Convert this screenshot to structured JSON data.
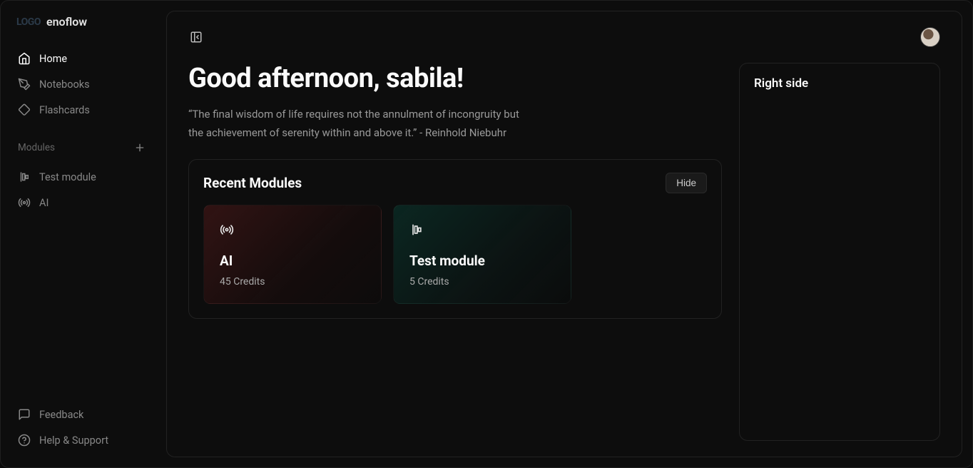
{
  "brand": {
    "logo": "LOGO",
    "name": "enoflow"
  },
  "nav": {
    "primary": [
      {
        "label": "Home",
        "icon": "home-icon",
        "active": true
      },
      {
        "label": "Notebooks",
        "icon": "pen-icon",
        "active": false
      },
      {
        "label": "Flashcards",
        "icon": "diamond-icon",
        "active": false
      }
    ],
    "modules_label": "Modules",
    "module_items": [
      {
        "label": "Test module",
        "icon": "align-icon"
      },
      {
        "label": "AI",
        "icon": "radio-icon"
      }
    ],
    "footer": [
      {
        "label": "Feedback",
        "icon": "message-icon"
      },
      {
        "label": "Help & Support",
        "icon": "help-icon"
      }
    ]
  },
  "main": {
    "greeting": "Good afternoon, sabila!",
    "quote": "“The final wisdom of life requires not the annulment of incongruity but the achievement of serenity within and above it.” - Reinhold Niebuhr",
    "recent": {
      "title": "Recent Modules",
      "hide_label": "Hide",
      "cards": [
        {
          "title": "AI",
          "credits": "45 Credits",
          "theme": "red",
          "icon": "radio-icon"
        },
        {
          "title": "Test module",
          "credits": "5 Credits",
          "theme": "teal",
          "icon": "align-icon"
        }
      ]
    }
  },
  "right": {
    "title": "Right side"
  }
}
